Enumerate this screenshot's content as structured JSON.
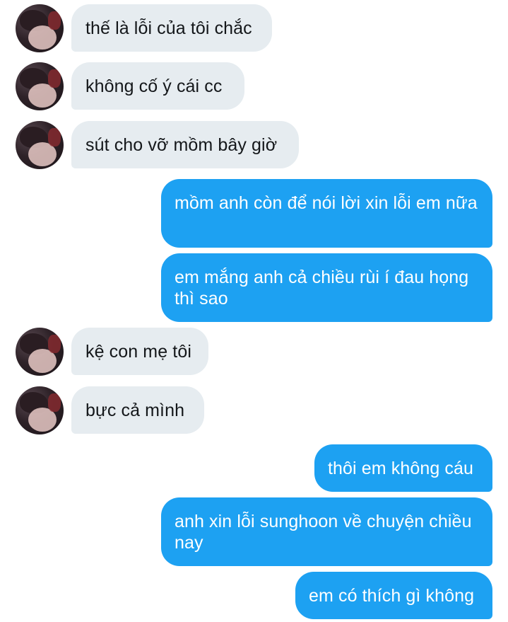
{
  "conversation": {
    "messages": [
      {
        "direction": "in",
        "avatar_icon": "user-avatar-icon",
        "text": "thế là lỗi của tôi chắc"
      },
      {
        "direction": "in",
        "avatar_icon": "user-avatar-icon",
        "text": "không cố ý cái cc"
      },
      {
        "direction": "in",
        "avatar_icon": "user-avatar-icon",
        "text": "sút cho vỡ mồm bây giờ"
      },
      {
        "direction": "out",
        "text": "mồm anh còn để nói lời xin lỗi em nữa"
      },
      {
        "direction": "out",
        "text": "em mắng anh cả chiều rùi í đau họng thì sao"
      },
      {
        "direction": "in",
        "avatar_icon": "user-avatar-icon",
        "text": "kệ con mẹ tôi"
      },
      {
        "direction": "in",
        "avatar_icon": "user-avatar-icon",
        "text": "bực cả mình"
      },
      {
        "direction": "out",
        "text": "thôi em không cáu"
      },
      {
        "direction": "out",
        "text": "anh xin lỗi sunghoon về chuyện chiều nay"
      },
      {
        "direction": "out",
        "text": "em có thích gì không"
      }
    ]
  },
  "colors": {
    "incoming_bubble": "#e6ecf0",
    "outgoing_bubble": "#1da1f2",
    "incoming_text": "#14171a",
    "outgoing_text": "#ffffff"
  }
}
